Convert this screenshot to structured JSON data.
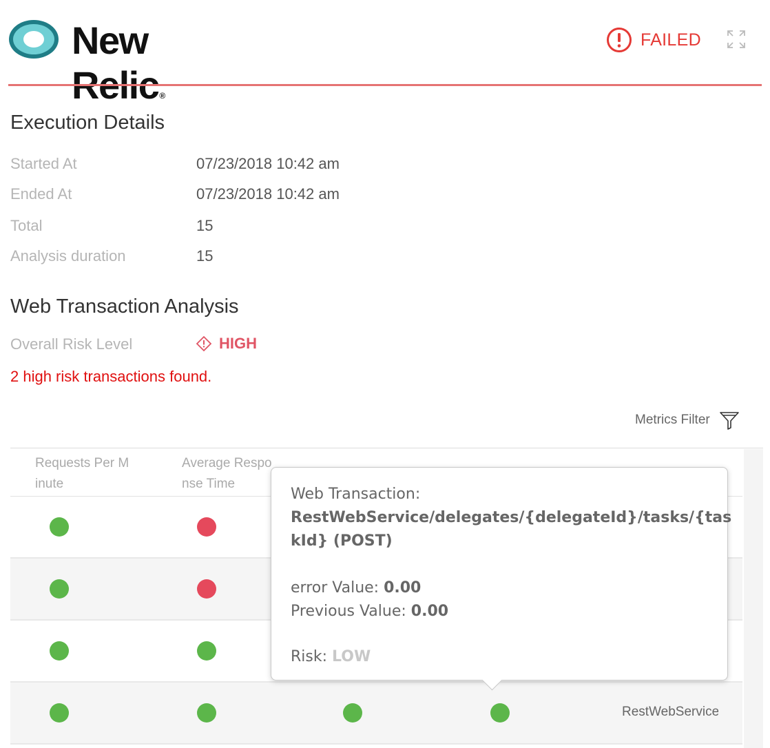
{
  "header": {
    "brand_name": "New Relic",
    "brand_registered": "®",
    "status_label": "FAILED",
    "status_icon": "exclamation-circle-icon",
    "expand_icon": "expand-icon",
    "colors": {
      "failed": "#e53935",
      "rule": "#e57373",
      "logo_teal": "#2a9aa3"
    }
  },
  "execution": {
    "title": "Execution Details",
    "started_label": "Started At",
    "started_value": "07/23/2018 10:42 am",
    "ended_label": "Ended At",
    "ended_value": "07/23/2018 10:42 am",
    "total_label": "Total",
    "total_value": "15",
    "duration_label": "Analysis duration",
    "duration_value": "15"
  },
  "analysis": {
    "title": "Web Transaction Analysis",
    "risk_label": "Overall Risk Level",
    "risk_value": "HIGH",
    "risk_icon": "diamond-alert-icon",
    "warning": "2 high risk transactions found."
  },
  "table": {
    "filter_label": "Metrics Filter",
    "filter_icon": "funnel-icon",
    "headers": {
      "requests_l1": "Requests Per M",
      "requests_l2": "inute",
      "response_l1": "Average Respo",
      "response_l2": "nse Time"
    },
    "rows": [
      {
        "requests": "green",
        "response": "red"
      },
      {
        "requests": "green",
        "response": "red"
      },
      {
        "requests": "green",
        "response": "green"
      },
      {
        "requests": "green",
        "response": "green",
        "col3": "green",
        "col4": "green",
        "name": "RestWebService"
      }
    ],
    "colors": {
      "green": "#5cb64a",
      "red": "#e5495c"
    }
  },
  "tooltip": {
    "label": "Web Transaction:",
    "name_l1": "RestWebService/delegates/{delegateId}/tasks/{tas",
    "name_l2": "kId} (POST)",
    "error_label": "error Value: ",
    "error_value": "0.00",
    "prev_label": "Previous Value: ",
    "prev_value": "0.00",
    "risk_label": "Risk: ",
    "risk_value": "LOW"
  }
}
